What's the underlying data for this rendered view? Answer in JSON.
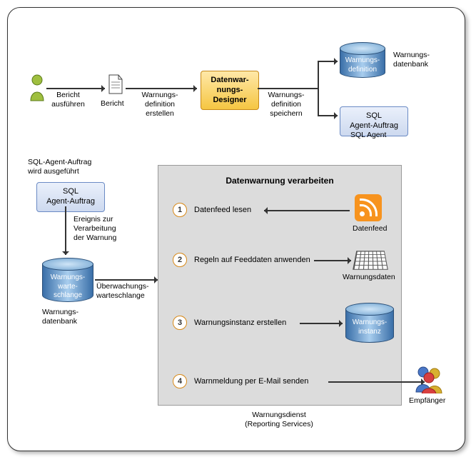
{
  "top": {
    "run_report": "Bericht\nausführen",
    "report": "Bericht",
    "create_def": "Warnungs-\ndefinition\nerstellen",
    "designer": "Datenwar-\nnungs-\nDesigner",
    "save_def": "Warnungs-\ndefinition\nspeichern",
    "alert_def": "Warnungs-\ndefinition",
    "alert_db": "Warnungs-\ndatenbank",
    "agent_job": "SQL\nAgent-Auftrag",
    "sql_agent": "SQL Agent"
  },
  "left": {
    "job_runs": "SQL-Agent-Auftrag\nwird ausgeführt",
    "agent_job": "SQL\nAgent-Auftrag",
    "event": "Ereignis zur\nVerarbeitung\nder Warnung",
    "queue": "Warnungs-\nwarte-\nschlange",
    "alert_db": "Warnungs-\ndatenbank",
    "mon_queue": "Überwachungs-\nwarteschlange"
  },
  "panel": {
    "title": "Datenwarnung verarbeiten",
    "s1": "Datenfeed lesen",
    "s2": "Regeln auf Feeddaten anwenden",
    "s3": "Warnungsinstanz erstellen",
    "s4": "Warnmeldung per E-Mail senden",
    "datafeed": "Datenfeed",
    "alert_data": "Warnungsdaten",
    "instance": "Warnungs-\ninstanz",
    "recipients": "Empfänger",
    "service": "Warnungsdienst\n(Reporting Services)"
  },
  "nums": {
    "n1": "1",
    "n2": "2",
    "n3": "3",
    "n4": "4"
  }
}
